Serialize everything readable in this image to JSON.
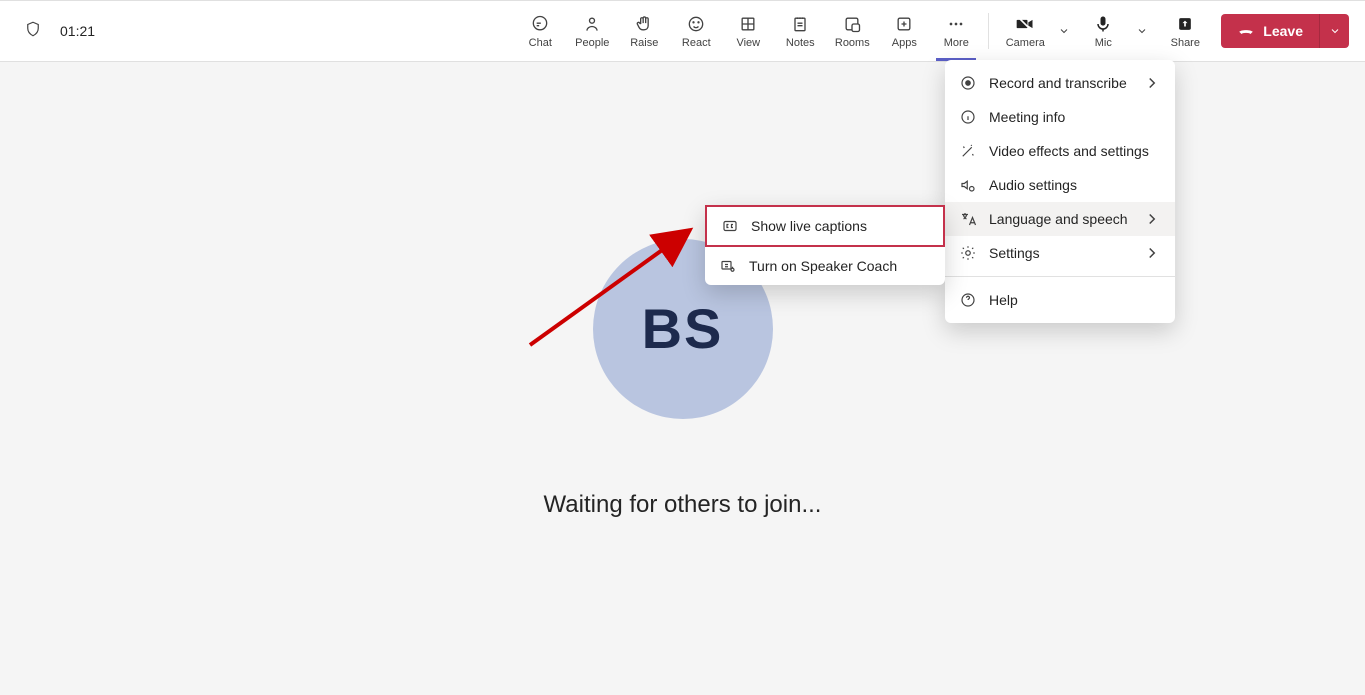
{
  "timer": "01:21",
  "toolbar": {
    "chat": "Chat",
    "people": "People",
    "raise": "Raise",
    "react": "React",
    "view": "View",
    "notes": "Notes",
    "rooms": "Rooms",
    "apps": "Apps",
    "more": "More",
    "camera": "Camera",
    "mic": "Mic",
    "share": "Share",
    "leave": "Leave"
  },
  "more_menu": {
    "record": "Record and transcribe",
    "meeting_info": "Meeting info",
    "video_effects": "Video effects and settings",
    "audio_settings": "Audio settings",
    "language_speech": "Language and speech",
    "settings": "Settings",
    "help": "Help"
  },
  "lang_menu": {
    "show_captions": "Show live captions",
    "speaker_coach": "Turn on Speaker Coach"
  },
  "avatar_initials": "BS",
  "waiting_text": "Waiting for others to join..."
}
